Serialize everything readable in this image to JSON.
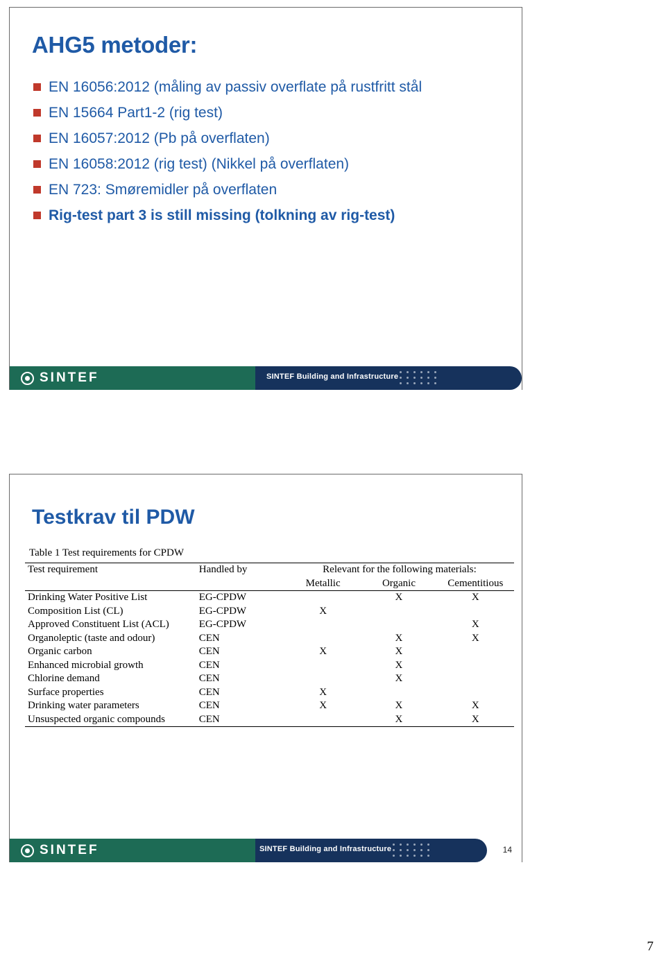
{
  "slide1": {
    "title": "AHG5 metoder:",
    "bullets": [
      {
        "text": "EN 16056:2012 (måling av passiv overflate på rustfritt stål",
        "bold": false
      },
      {
        "text": "EN 15664 Part1-2 (rig test)",
        "bold": false
      },
      {
        "text": "EN 16057:2012 (Pb på overflaten)",
        "bold": false
      },
      {
        "text": "EN 16058:2012 (rig test) (Nikkel på overflaten)",
        "bold": false
      },
      {
        "text": "EN 723: Smøremidler på overflaten",
        "bold": false
      },
      {
        "text": "Rig-test part 3 is still missing (tolkning av rig-test)",
        "bold": true
      }
    ],
    "footer": {
      "logo_text": "SINTEF",
      "label": "SINTEF Building and Infrastructure"
    }
  },
  "slide2": {
    "title": "Testkrav til PDW",
    "caption": "Table 1 Test requirements for CPDW",
    "headers": {
      "test_requirement": "Test requirement",
      "handled_by": "Handled by",
      "materials_group": "Relevant for the following materials:",
      "metallic": "Metallic",
      "organic": "Organic",
      "cementitious": "Cementitious"
    },
    "rows": [
      {
        "requirement": "Drinking Water Positive List",
        "handled_by": "EG-CPDW",
        "metallic": "",
        "organic": "X",
        "cementitious": "X"
      },
      {
        "requirement": "Composition List (CL)",
        "handled_by": "EG-CPDW",
        "metallic": "X",
        "organic": "",
        "cementitious": ""
      },
      {
        "requirement": "Approved Constituent List (ACL)",
        "handled_by": "EG-CPDW",
        "metallic": "",
        "organic": "",
        "cementitious": "X"
      },
      {
        "requirement": "Organoleptic (taste and odour)",
        "handled_by": "CEN",
        "metallic": "",
        "organic": "X",
        "cementitious": "X"
      },
      {
        "requirement": "Organic carbon",
        "handled_by": "CEN",
        "metallic": "X",
        "organic": "X",
        "cementitious": ""
      },
      {
        "requirement": "Enhanced microbial growth",
        "handled_by": "CEN",
        "metallic": "",
        "organic": "X",
        "cementitious": ""
      },
      {
        "requirement": "Chlorine demand",
        "handled_by": "CEN",
        "metallic": "",
        "organic": "X",
        "cementitious": ""
      },
      {
        "requirement": "Surface properties",
        "handled_by": "CEN",
        "metallic": "X",
        "organic": "",
        "cementitious": ""
      },
      {
        "requirement": "Drinking water parameters",
        "handled_by": "CEN",
        "metallic": "X",
        "organic": "X",
        "cementitious": "X"
      },
      {
        "requirement": "Unsuspected organic compounds",
        "handled_by": "CEN",
        "metallic": "",
        "organic": "X",
        "cementitious": "X"
      }
    ],
    "footer": {
      "logo_text": "SINTEF",
      "label": "SINTEF Building and Infrastructure",
      "slide_number": "14"
    }
  },
  "page_number": "7"
}
